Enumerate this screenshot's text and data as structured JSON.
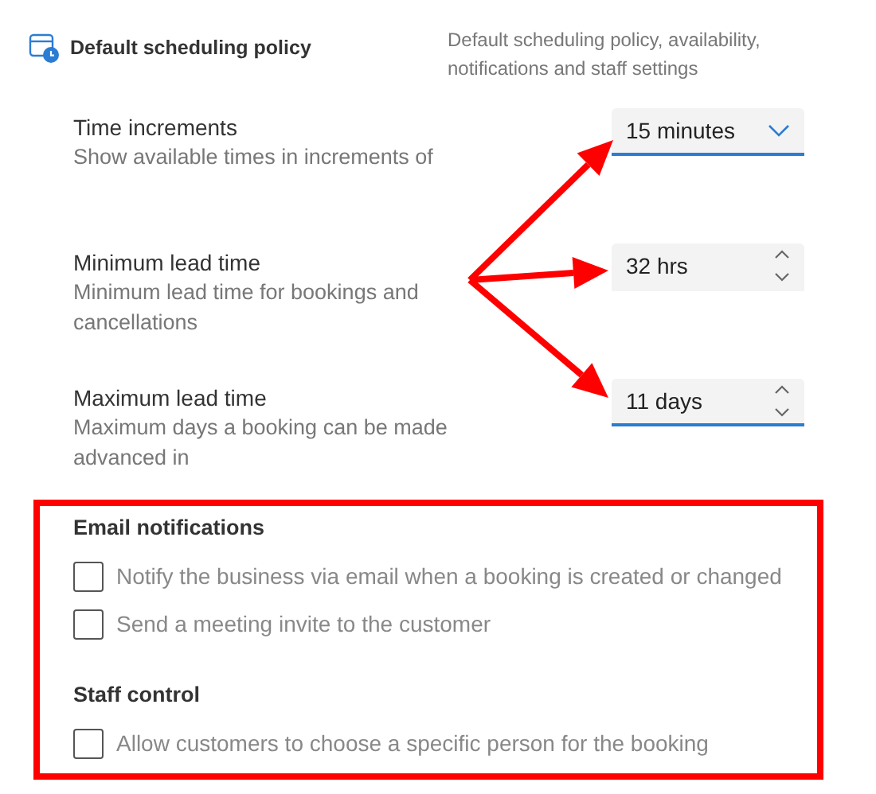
{
  "header": {
    "title": "Default scheduling policy",
    "description": "Default scheduling policy, availability, notifications and staff settings"
  },
  "settings": [
    {
      "label": "Time increments",
      "description": "Show available times in increments of",
      "control": {
        "kind": "dropdown",
        "value": "15 minutes",
        "focused": true
      }
    },
    {
      "label": "Minimum lead time",
      "description": "Minimum lead time for bookings and cancellations",
      "control": {
        "kind": "stepper",
        "value": "32 hrs",
        "focused": false
      }
    },
    {
      "label": "Maximum lead time",
      "description": "Maximum days a booking can be made advanced in",
      "control": {
        "kind": "stepper",
        "value": "11 days",
        "focused": true
      }
    }
  ],
  "sections": [
    {
      "heading": "Email notifications",
      "options": [
        {
          "label": "Notify the business via email when a booking is created or changed",
          "checked": false
        },
        {
          "label": "Send a meeting invite to the customer",
          "checked": false
        }
      ]
    },
    {
      "heading": "Staff control",
      "options": [
        {
          "label": "Allow customers to choose a specific person for the booking",
          "checked": false
        }
      ]
    }
  ]
}
